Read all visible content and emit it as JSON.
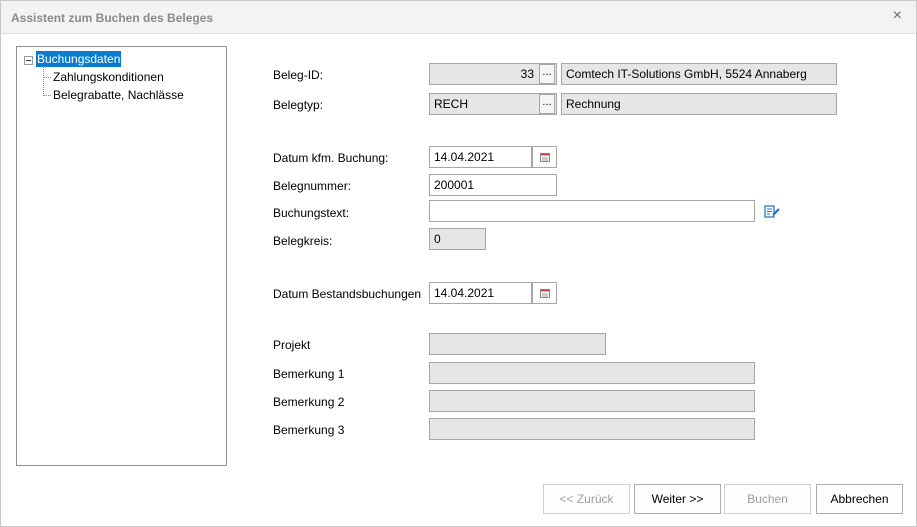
{
  "window": {
    "title": "Assistent zum Buchen des Beleges",
    "close_glyph": "×"
  },
  "tree": {
    "items": [
      {
        "label": "Buchungsdaten",
        "selected": true
      },
      {
        "label": "Zahlungskonditionen",
        "selected": false
      },
      {
        "label": "Belegrabatte, Nachlässe",
        "selected": false
      }
    ]
  },
  "form": {
    "beleg_id": {
      "label": "Beleg-ID:",
      "value": "33",
      "ellipsis": "...",
      "name": "Comtech IT-Solutions GmbH, 5524 Annaberg"
    },
    "belegtyp": {
      "label": "Belegtyp:",
      "value": "RECH",
      "ellipsis": "...",
      "name": "Rechnung"
    },
    "datum_kfm": {
      "label": "Datum kfm. Buchung:",
      "value": "14.04.2021"
    },
    "belegnummer": {
      "label": "Belegnummer:",
      "value": "200001"
    },
    "buchungstext": {
      "label": "Buchungstext:",
      "value": ""
    },
    "belegkreis": {
      "label": "Belegkreis:",
      "value": "0"
    },
    "datum_bestand": {
      "label": "Datum Bestandsbuchungen",
      "value": "14.04.2021"
    },
    "projekt": {
      "label": "Projekt",
      "value": ""
    },
    "bemerkung1": {
      "label": "Bemerkung 1",
      "value": ""
    },
    "bemerkung2": {
      "label": "Bemerkung 2",
      "value": ""
    },
    "bemerkung3": {
      "label": "Bemerkung 3",
      "value": ""
    }
  },
  "buttons": {
    "back": "<< Zurück",
    "next": "Weiter >>",
    "book": "Buchen",
    "cancel": "Abbrechen"
  },
  "icons": {
    "calendar": "calendar-icon",
    "edit": "edit-text-icon",
    "tree_expander": "collapse-icon"
  },
  "colors": {
    "selection": "#0a7ccf",
    "readonly_bg": "#e6e6e6",
    "edit_icon": "#1f6fb8"
  }
}
